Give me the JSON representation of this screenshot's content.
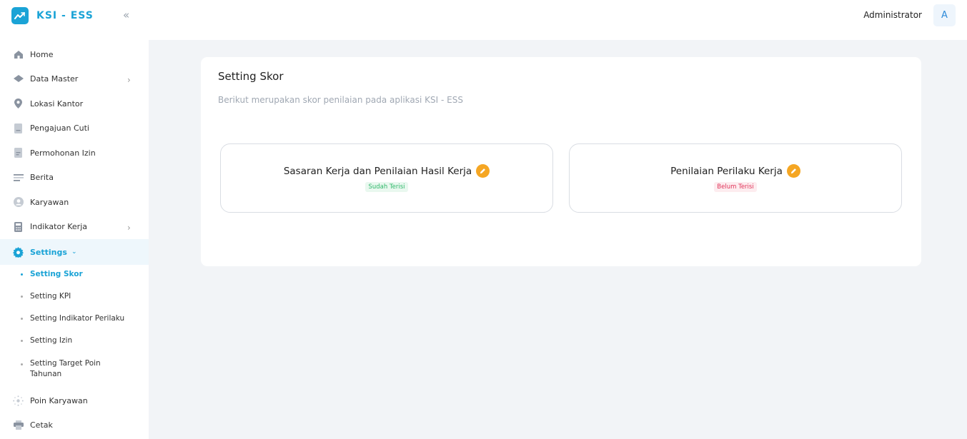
{
  "app": {
    "name": "KSI - ESS"
  },
  "header": {
    "user_name": "Administrator",
    "avatar_initial": "A"
  },
  "sidebar": {
    "items": [
      {
        "label": "Home",
        "icon": "home-icon"
      },
      {
        "label": "Data Master",
        "icon": "layers-icon",
        "has_children": true
      },
      {
        "label": "Lokasi Kantor",
        "icon": "location-pin-icon"
      },
      {
        "label": "Pengajuan Cuti",
        "icon": "document-icon"
      },
      {
        "label": "Permohonan Izin",
        "icon": "document-lines-icon"
      },
      {
        "label": "Berita",
        "icon": "menu-lines-icon"
      },
      {
        "label": "Karyawan",
        "icon": "user-icon"
      },
      {
        "label": "Indikator Kerja",
        "icon": "calculator-icon",
        "has_children": true
      },
      {
        "label": "Settings",
        "icon": "gear-icon",
        "expanded": true
      }
    ],
    "settings_submenu": [
      {
        "label": "Setting Skor",
        "active": true
      },
      {
        "label": "Setting KPI"
      },
      {
        "label": "Setting Indikator Perilaku"
      },
      {
        "label": "Setting Izin"
      },
      {
        "label": "Setting Target Poin Tahunan"
      }
    ],
    "bottom_items": [
      {
        "label": "Poin Karyawan",
        "icon": "sparkle-icon"
      },
      {
        "label": "Cetak",
        "icon": "printer-icon"
      }
    ]
  },
  "main": {
    "title": "Setting Skor",
    "subtitle": "Berikut merupakan skor penilaian pada aplikasi KSI - ESS",
    "cards": [
      {
        "label": "Sasaran Kerja dan Penilaian Hasil Kerja",
        "status": "Sudah Terisi",
        "status_color": "#2fb86a"
      },
      {
        "label": "Penilaian Perilaku Kerja",
        "status": "Belum Terisi",
        "status_color": "#e0345a"
      }
    ]
  },
  "colors": {
    "accent": "#1aa3d6",
    "edit": "#f5a623"
  }
}
